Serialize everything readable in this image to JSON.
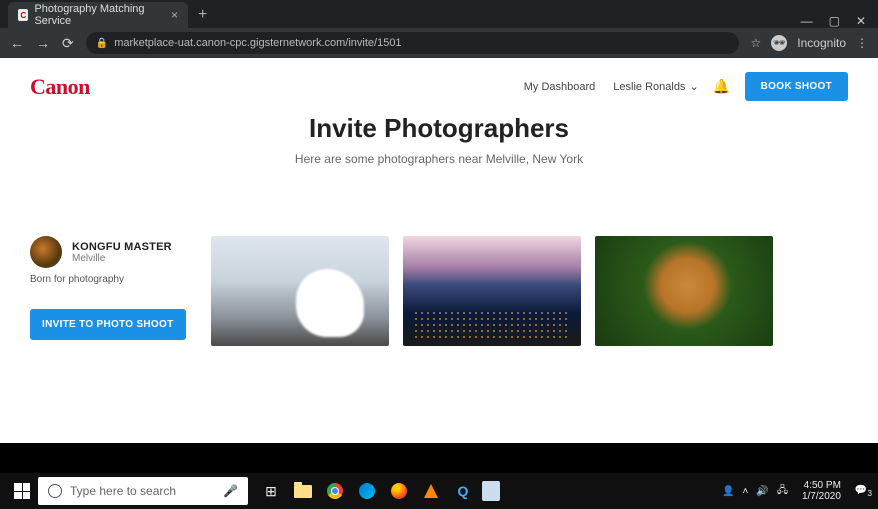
{
  "browser": {
    "tab_title": "Photography Matching Service",
    "url": "marketplace-uat.canon-cpc.gigsternetwork.com/invite/1501",
    "incognito_label": "Incognito"
  },
  "header": {
    "logo": "Canon",
    "dashboard_link": "My Dashboard",
    "user_name": "Leslie Ronalds",
    "book_button": "BOOK SHOOT"
  },
  "hero": {
    "title": "Invite Photographers",
    "subtitle": "Here are some photographers near Melville, New York"
  },
  "photographer": {
    "name": "KONGFU MASTER",
    "location": "Melville",
    "bio": "Born for photography",
    "invite_button": "INVITE TO PHOTO SHOOT"
  },
  "taskbar": {
    "search_placeholder": "Type here to search",
    "time": "4:50 PM",
    "date": "1/7/2020",
    "notification_count": "3"
  }
}
